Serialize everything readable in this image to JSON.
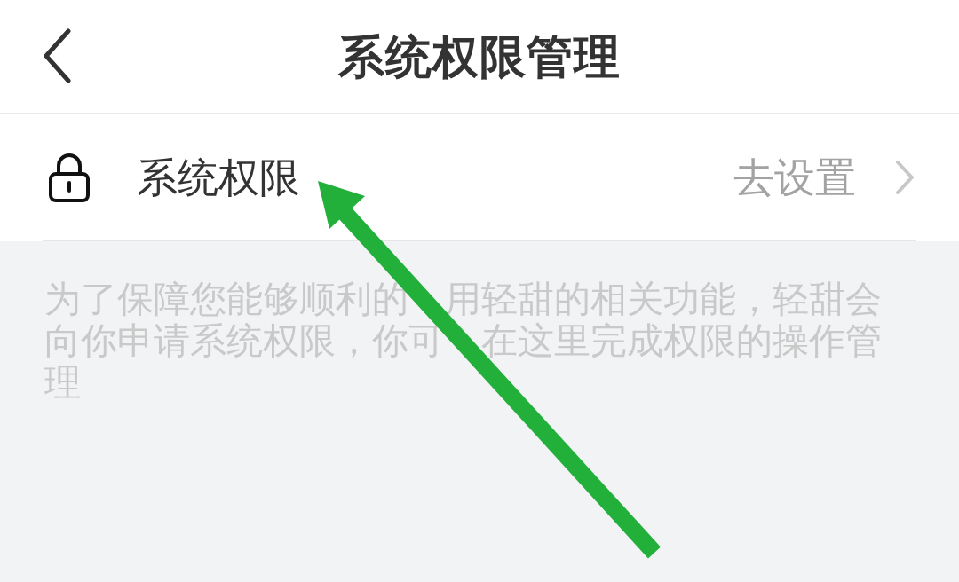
{
  "header": {
    "title": "系统权限管理"
  },
  "items": [
    {
      "label": "系统权限",
      "action": "去设置"
    }
  ],
  "description_lines": [
    {
      "segments": [
        "为了保障您能够顺利的",
        "用轻甜的相关功能，轻甜会"
      ]
    },
    {
      "segments": [
        "向你申请系统权限，你可",
        "在这里完成权限的操作管"
      ]
    },
    {
      "segments": [
        "理"
      ]
    }
  ]
}
